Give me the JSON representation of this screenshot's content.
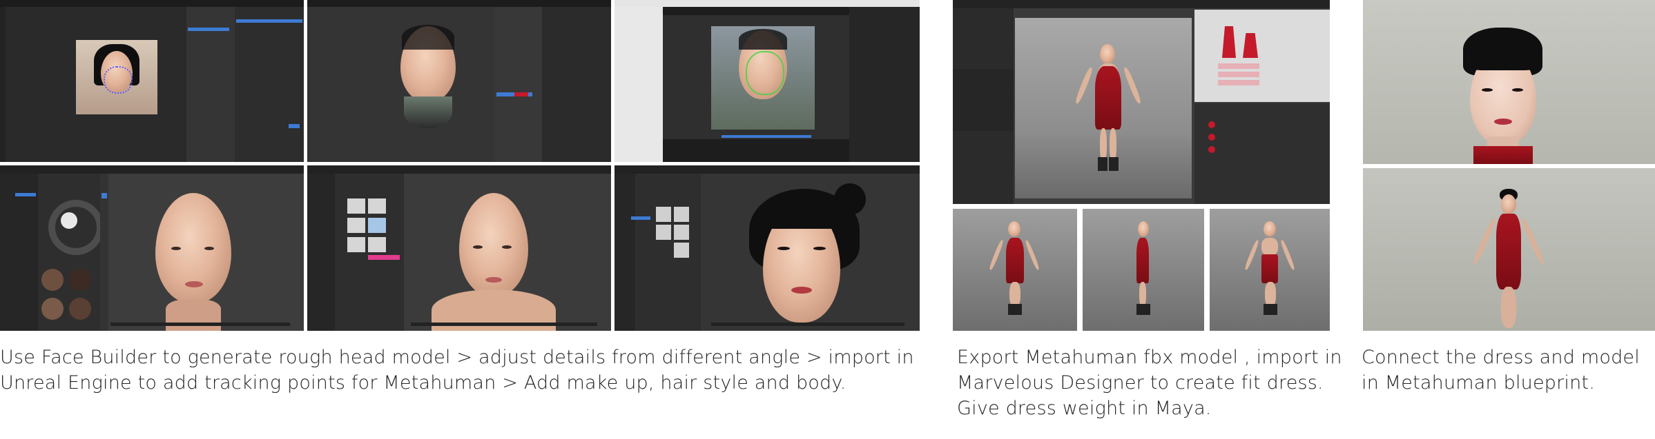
{
  "captions": {
    "left": "Use Face Builder to generate rough head model > adjust details from different angle > import in Unreal Engine to add tracking points for Metahuman > Add make up, hair style and body.",
    "middle": "Export Metahuman fbx model , import in Marvelous Designer to create fit dress. Give dress weight in Maya.",
    "right": "Connect the dress and model in Metahuman blueprint."
  },
  "colors": {
    "app_dark": "#2a2a2a",
    "accent_blue": "#3d7bd4",
    "dress_red": "#b0141f",
    "caption_text": "#222222"
  },
  "icons": [
    "tracking-point-icon",
    "hair-preset-icon",
    "eye-preset-icon"
  ]
}
